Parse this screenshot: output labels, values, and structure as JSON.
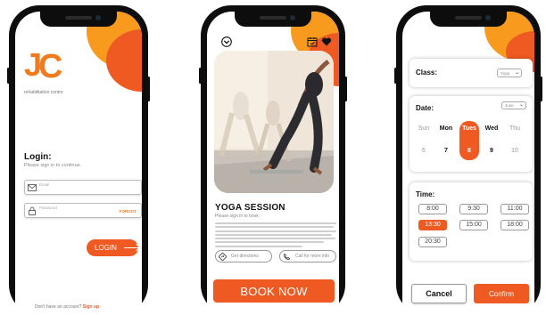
{
  "colors": {
    "accent": "#ef5a22",
    "accent_light": "#f79a1e",
    "text_dark": "#111111",
    "muted": "#888888"
  },
  "login_screen": {
    "logo_text": "JC",
    "logo_subtitle": "rehabilitation centre",
    "title": "Login:",
    "subtitle": "Please sign in to continue.",
    "email_placeholder": "Email",
    "password_placeholder": "Password",
    "forgot_label": "FORGOT",
    "login_button": "LOGIN",
    "signup_prompt": "Don't have an account?",
    "signup_link": "Sign up"
  },
  "session_screen": {
    "title": "YOGA SESSION",
    "subtitle": "Please sign in to book",
    "directions_label": "Get directions",
    "call_label": "Call for more info",
    "book_button": "BOOK NOW",
    "icons": [
      "chevron-down-icon",
      "calendar-icon",
      "heart-icon",
      "directions-icon",
      "phone-icon"
    ]
  },
  "booking_screen": {
    "class_label": "Class:",
    "class_value": "Yoga",
    "date_label": "Date:",
    "date_value": "June",
    "days": [
      {
        "name": "Sun",
        "date": "6",
        "emphasis": false
      },
      {
        "name": "Mon",
        "date": "7",
        "emphasis": true
      },
      {
        "name": "Tues",
        "date": "8",
        "emphasis": true,
        "selected": true
      },
      {
        "name": "Wed",
        "date": "9",
        "emphasis": true
      },
      {
        "name": "Thu",
        "date": "10",
        "emphasis": false
      }
    ],
    "time_label": "Time:",
    "times": [
      {
        "label": "8:00",
        "selected": false
      },
      {
        "label": "9:30",
        "selected": false
      },
      {
        "label": "11:00",
        "selected": false
      },
      {
        "label": "13:30",
        "selected": true
      },
      {
        "label": "15:00",
        "selected": false
      },
      {
        "label": "18:00",
        "selected": false
      },
      {
        "label": "20:30",
        "selected": false
      }
    ],
    "cancel_button": "Cancel",
    "confirm_button": "Confirm"
  }
}
